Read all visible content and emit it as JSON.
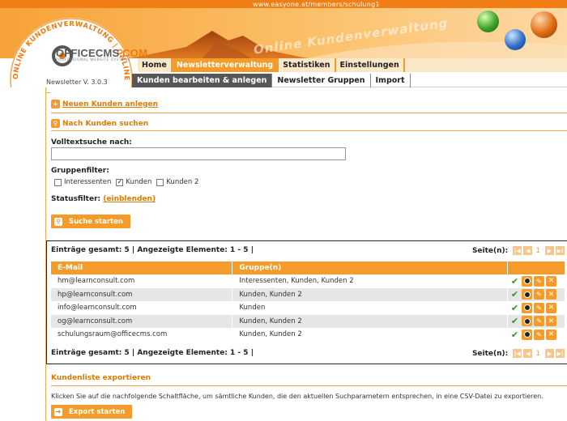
{
  "header": {
    "url": "www.easyone.at/members/schulung1",
    "title": "Online Kundenverwaltung",
    "logo_main": "OFFICECMS",
    "logo_suffix": ".COM",
    "logo_ring_text": "ONLINE KUNDENVERWALTUNG | ONLINE KUNDENVERWALTUNG",
    "logo_tagline": "PROFESSIONAL WEBSITE SYSTEMS",
    "version": "Newsletter V. 3.0.3"
  },
  "nav": {
    "primary": [
      {
        "label": "Home",
        "active": false
      },
      {
        "label": "Newsletterverwaltung",
        "active": true
      },
      {
        "label": "Statistiken",
        "active": false
      },
      {
        "label": "Einstellungen",
        "active": false
      }
    ],
    "secondary": [
      {
        "label": "Kunden bearbeiten & anlegen",
        "active": true
      },
      {
        "label": "Newsletter Gruppen",
        "active": false
      },
      {
        "label": "Import",
        "active": false
      }
    ]
  },
  "actions": {
    "new_customer": "Neuen Kunden anlegen",
    "search_customer": "Nach Kunden suchen"
  },
  "search": {
    "fulltext_label": "Volltextsuche nach:",
    "fulltext_value": "",
    "groupfilter_label": "Gruppenfilter:",
    "groups": [
      {
        "label": "Interessenten",
        "checked": false
      },
      {
        "label": "Kunden",
        "checked": true
      },
      {
        "label": "Kunden 2",
        "checked": false
      }
    ],
    "statusfilter_label": "Statusfilter:",
    "statusfilter_link": "(einblenden)",
    "button": "Suche starten"
  },
  "results": {
    "summary": "Einträge gesamt: 5  |  Angezeigte Elemente: 1 - 5  |",
    "page_label": "Seite(n):",
    "page_current": "1",
    "columns": [
      "E-Mail",
      "Gruppe(n)"
    ],
    "rows": [
      {
        "email": "hm@learnconsult.com",
        "groups": "Interessenten, Kunden, Kunden 2"
      },
      {
        "email": "hp@learnconsult.com",
        "groups": "Kunden, Kunden 2"
      },
      {
        "email": "info@learnconsult.com",
        "groups": "Kunden"
      },
      {
        "email": "og@learnconsult.com",
        "groups": "Kunden, Kunden 2"
      },
      {
        "email": "schulungsraum@officecms.com",
        "groups": "Kunden, Kunden 2"
      }
    ]
  },
  "export": {
    "title": "Kundenliste exportieren",
    "text": "Klicken Sie auf die nachfolgende Schaltfläche, um sämtliche Kunden, die den aktuellen Suchparametern entsprechen, in eine CSV-Datei zu exportieren.",
    "button": "Export starten"
  },
  "colors": {
    "accent": "#f49b2a",
    "link": "#e07a00",
    "nav_active_secondary": "#575757",
    "ok_green": "#2c9a14"
  },
  "icons": {
    "new_customer": "add-user-icon",
    "search": "magnifier-icon",
    "row_actions": [
      "check-icon",
      "mail-status-icon",
      "edit-pencil-icon",
      "delete-x-icon"
    ],
    "pager": [
      "first-page-icon",
      "prev-page-icon",
      "next-page-icon",
      "last-page-icon"
    ]
  }
}
